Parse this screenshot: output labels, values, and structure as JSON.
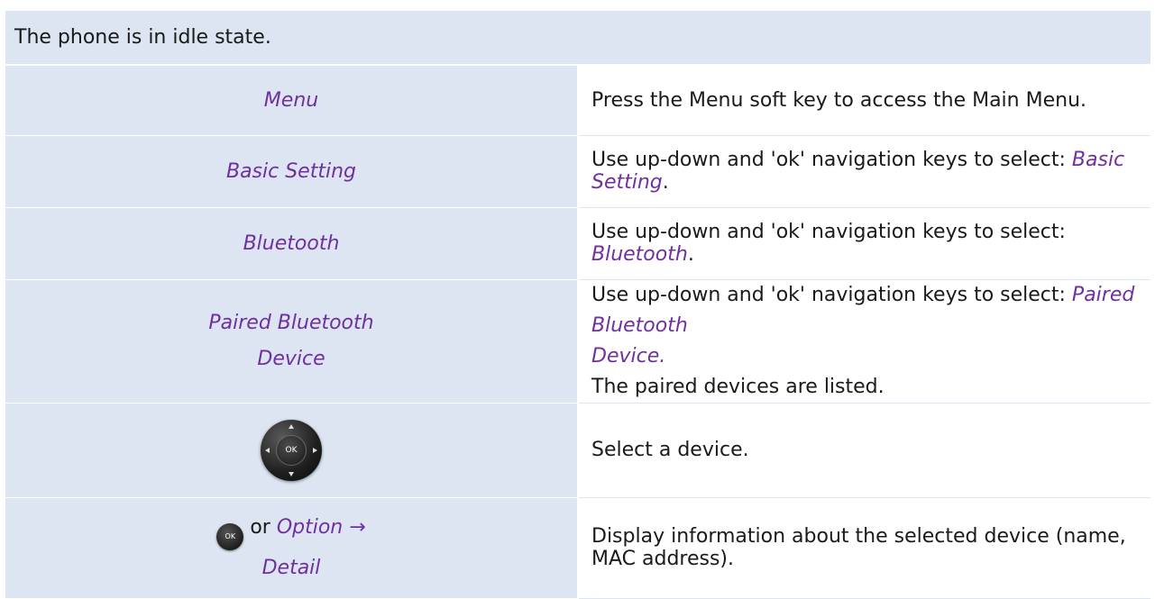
{
  "header": {
    "text": "The phone is in idle state."
  },
  "rows": [
    {
      "key": "Menu",
      "desc": "Press the Menu soft key to access the Main Menu."
    },
    {
      "key": "Basic Setting",
      "desc_prefix": "Use up-down and 'ok' navigation keys to select: ",
      "desc_item": "Basic Setting",
      "desc_suffix": "."
    },
    {
      "key": "Bluetooth",
      "desc_prefix": "Use up-down and 'ok' navigation keys to select: ",
      "desc_item": "Bluetooth",
      "desc_suffix": "."
    },
    {
      "key_line1": "Paired Bluetooth",
      "key_line2": "Device",
      "desc_prefix": "Use up-down and 'ok' navigation keys to select: ",
      "desc_item_line1": "Paired Bluetooth",
      "desc_item_line2": "Device.",
      "desc_after": "The paired devices are listed."
    },
    {
      "key_icon": "navigation-pad-icon",
      "key_icon_label": "OK",
      "desc": "Select a device."
    },
    {
      "key_icon": "ok-key-icon",
      "key_icon_label": "OK",
      "key_or": "or",
      "key_line1": "Option →",
      "key_line2": "Detail",
      "desc": "Display information about the selected device (name, MAC address)."
    }
  ],
  "colors": {
    "header_bg": "#dce5f1",
    "key_bg": "#dce5f1",
    "accent_text": "#7030a0"
  }
}
